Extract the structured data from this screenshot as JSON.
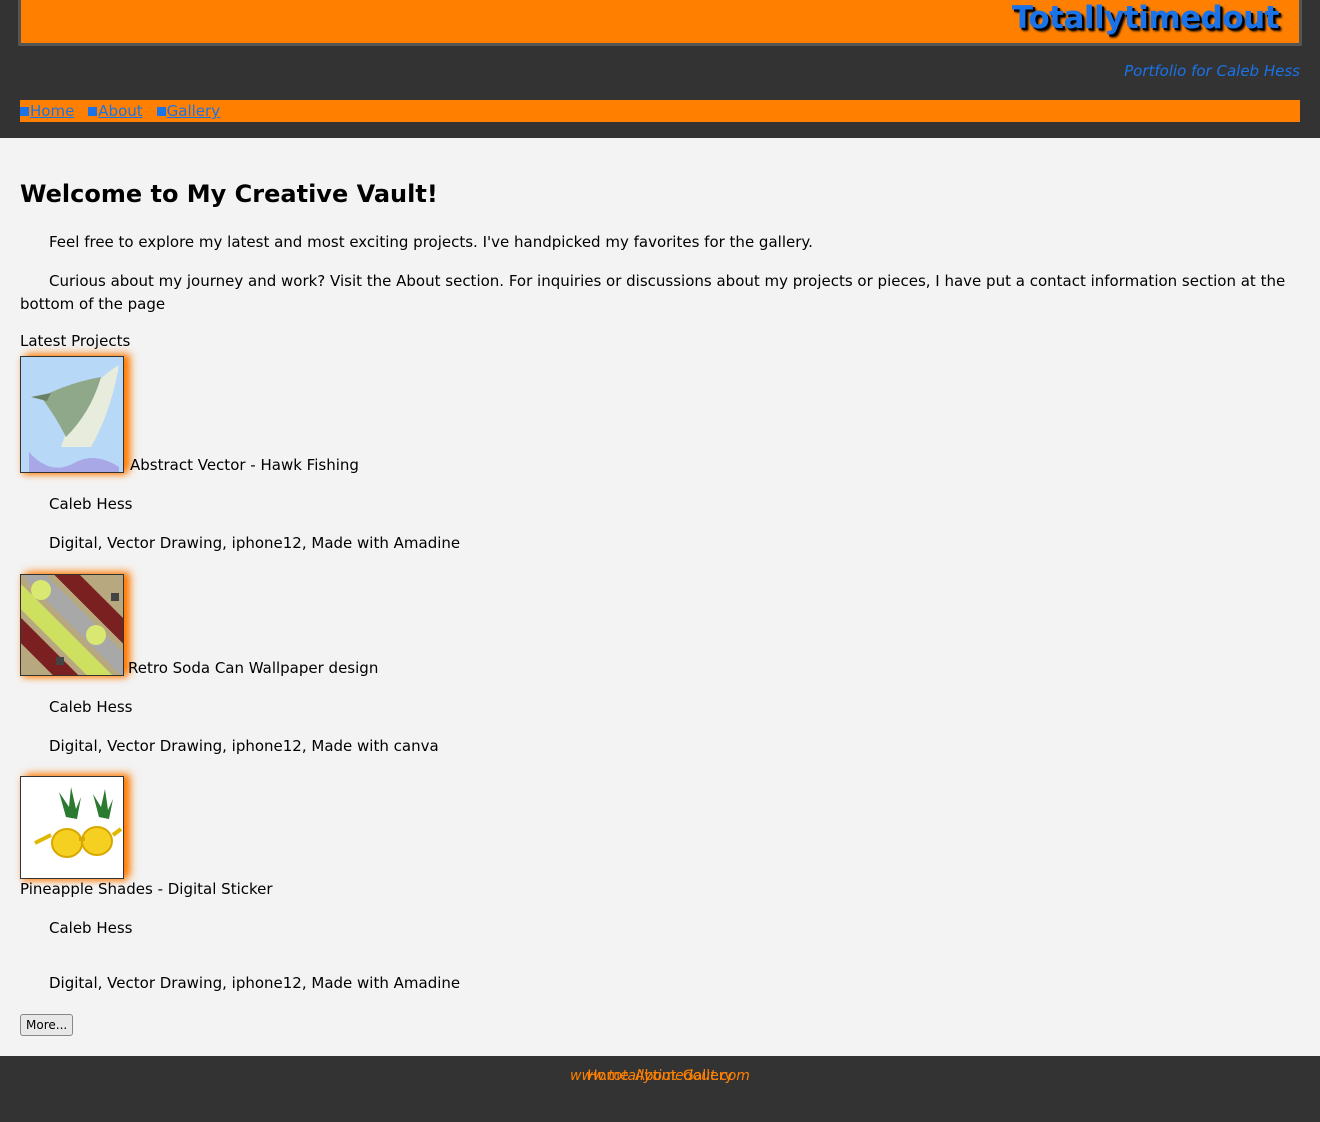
{
  "header": {
    "site_title": "Totallytimedout",
    "subtitle": "Portfolio for Caleb Hess",
    "nav": [
      {
        "label": "Home"
      },
      {
        "label": "About"
      },
      {
        "label": "Gallery"
      }
    ]
  },
  "main": {
    "heading": "Welcome to My Creative Vault!",
    "intro_1": "Feel free to explore my latest and most exciting projects. I've handpicked my favorites for the gallery.",
    "intro_2": "Curious about my journey and work? Visit the About section. For inquiries or discussions about my projects or pieces, I have put a contact information section at the bottom of the page",
    "section_label": "Latest Projects",
    "projects": [
      {
        "title": "Abstract Vector - Hawk Fishing",
        "author": "Caleb Hess",
        "details": "Digital, Vector Drawing, iphone12, Made with Amadine"
      },
      {
        "title": "Retro Soda Can Wallpaper design",
        "author": "Caleb Hess",
        "details": "Digital, Vector Drawing, iphone12, Made with canva"
      },
      {
        "title": "Pineapple Shades - Digital Sticker",
        "author": "Caleb Hess",
        "details": "Digital, Vector Drawing, iphone12, Made with Amadine"
      }
    ],
    "more_label": "More..."
  },
  "footer": {
    "site_url": "www.totallytimedout.com",
    "links": [
      "Home",
      "About",
      "Gallery"
    ]
  },
  "colors": {
    "accent_orange": "#ff8000",
    "link_blue": "#1a73e8",
    "dark_bg": "#333333"
  }
}
